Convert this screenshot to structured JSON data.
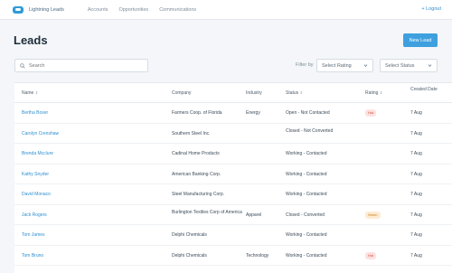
{
  "app": {
    "brand": "Lightning Leads",
    "nav": [
      "Accounts",
      "Opportunities",
      "Communications"
    ],
    "logout": "Logout"
  },
  "page": {
    "title": "Leads",
    "new_button": "New Lead"
  },
  "filters": {
    "search_placeholder": "Search",
    "filter_label": "Filter by",
    "rating_select": "Select Rating",
    "status_select": "Select Status"
  },
  "table": {
    "headers": {
      "name": "Name",
      "company": "Company",
      "industry": "Industry",
      "status": "Status",
      "rating": "Rating",
      "created": "Created Date"
    },
    "rows": [
      {
        "name": "Bertha Boxer",
        "company": "Farmers Coop. of Florida",
        "industry": "Energy",
        "status": "Open - Not Contacted",
        "rating": "Hot",
        "created": "7 Aug"
      },
      {
        "name": "Carolyn Crenshaw",
        "company": "Southern Steel Inc.",
        "industry": "",
        "status": "Closed - Not Converted",
        "rating": "",
        "created": "7 Aug"
      },
      {
        "name": "Brenda Mcclure",
        "company": "Cadinal Home Products",
        "industry": "",
        "status": "Working - Contacted",
        "rating": "",
        "created": "7 Aug"
      },
      {
        "name": "Kathy Snyder",
        "company": "American Banking Corp.",
        "industry": "",
        "status": "Working - Contacted",
        "rating": "",
        "created": "7 Aug"
      },
      {
        "name": "David Monaco",
        "company": "Steel Manufacturing Corp.",
        "industry": "",
        "status": "Working - Contacted",
        "rating": "",
        "created": "7 Aug"
      },
      {
        "name": "Jack Rogers",
        "company": "Burlington Textiles Corp of America",
        "industry": "Apparel",
        "status": "Closed - Converted",
        "rating": "Warm",
        "created": "7 Aug"
      },
      {
        "name": "Tom James",
        "company": "Delphi Chemicals",
        "industry": "",
        "status": "Working - Contacted",
        "rating": "",
        "created": "7 Aug"
      },
      {
        "name": "Tom Bruno",
        "company": "Delphi Chemicals",
        "industry": "Technology",
        "status": "Working - Contacted",
        "rating": "Hot",
        "created": "7 Aug"
      }
    ]
  },
  "colors": {
    "accent": "#3ea0df",
    "link": "#2f8fd0",
    "hot_badge_bg": "#fde2e0",
    "warm_badge_bg": "#fdebd3"
  }
}
